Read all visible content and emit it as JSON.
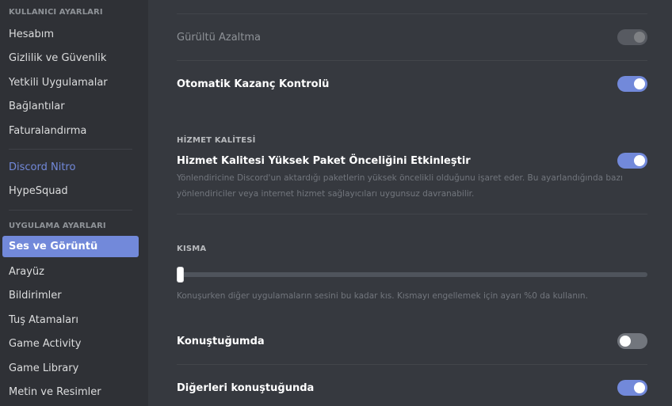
{
  "sidebar": {
    "user_settings_header": "KULLANICI AYARLARI",
    "user_items": [
      {
        "label": "Hesabım"
      },
      {
        "label": "Gizlilik ve Güvenlik"
      },
      {
        "label": "Yetkili Uygulamalar"
      },
      {
        "label": "Bağlantılar"
      },
      {
        "label": "Faturalandırma"
      }
    ],
    "nitro_items": [
      {
        "label": "Discord Nitro"
      },
      {
        "label": "HypeSquad"
      }
    ],
    "app_settings_header": "UYGULAMA AYARLARI",
    "app_items": [
      {
        "label": "Ses ve Görüntü",
        "selected": true
      },
      {
        "label": "Arayüz"
      },
      {
        "label": "Bildirimler"
      },
      {
        "label": "Tuş Atamaları"
      },
      {
        "label": "Game Activity"
      },
      {
        "label": "Game Library"
      },
      {
        "label": "Metin ve Resimler"
      }
    ]
  },
  "settings": {
    "noise_reduction": {
      "label": "Gürültü Azaltma",
      "state": "disabled-on"
    },
    "auto_gain": {
      "label": "Otomatik Kazanç Kontrolü",
      "state": "on"
    },
    "qos_header": "HİZMET KALİTESİ",
    "qos": {
      "label": "Hizmet Kalitesi Yüksek Paket Önceliğini Etkinleştir",
      "state": "on",
      "description_line1": "Yönlendiricine Discord'un aktardığı paketlerin yüksek öncelikli olduğunu işaret eder. Bu ayarlandığında bazı",
      "description_line2": "yönlendiriciler veya internet hizmet sağlayıcıları uygunsuz davranabilir."
    },
    "attenuation_header": "KISMA",
    "attenuation": {
      "value_percent": 0,
      "description": "Konuşurken diğer uygulamaların sesini bu kadar kıs. Kısmayı engellemek için ayarı %0 da kullanın."
    },
    "when_i_speak": {
      "label": "Konuştuğumda",
      "state": "off"
    },
    "when_others_speak": {
      "label": "Diğerleri konuştuğunda",
      "state": "on"
    }
  },
  "colors": {
    "accent": "#7289da",
    "sidebar_bg": "#2f3136",
    "content_bg": "#36393f"
  }
}
